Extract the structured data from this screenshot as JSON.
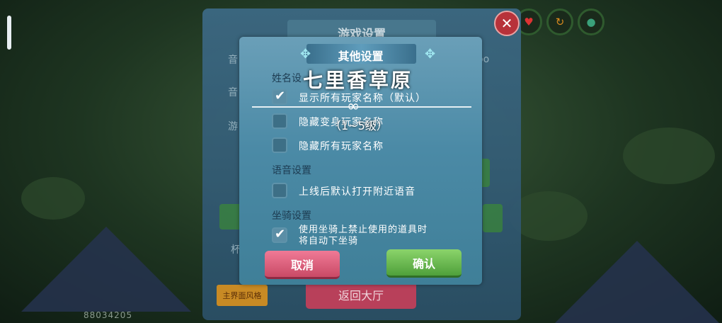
{
  "hud": {
    "player_id": "88034205",
    "icons": [
      "heart-icon",
      "arrow-icon",
      "drop-icon"
    ]
  },
  "back_panel": {
    "title": "游戏设置",
    "close_icon": "close-icon",
    "labels": [
      "音",
      "音",
      "游"
    ],
    "suffix_text": "oo",
    "bottom_left_label": "杯",
    "skin_button": "主界面风格",
    "lobby_button": "返回大厅"
  },
  "dialog": {
    "title": "其他设置",
    "sections": {
      "name": "姓名设",
      "voice": "语音设置",
      "mount": "坐骑设置"
    },
    "options": {
      "show_all": {
        "label": "显示所有玩家名称（默认）",
        "checked": true
      },
      "hide_self": {
        "label": "隐藏变身玩家名称",
        "checked": false
      },
      "hide_all": {
        "label": "隐藏所有玩家名称",
        "checked": false
      },
      "voice_nearby": {
        "label": "上线后默认打开附近语音",
        "checked": false
      },
      "mount_auto": {
        "line1": "使用坐骑上禁止使用的道具时",
        "line2": "将自动下坐骑",
        "checked": true
      }
    },
    "cancel": "取消",
    "confirm": "确认"
  },
  "area_banner": {
    "name": "七里香草原",
    "level": "（1~5级）"
  },
  "colors": {
    "dialog_bg": "#4b8aa6",
    "cancel": "#e0607c",
    "confirm": "#6cbb52",
    "close": "#b7323a"
  }
}
